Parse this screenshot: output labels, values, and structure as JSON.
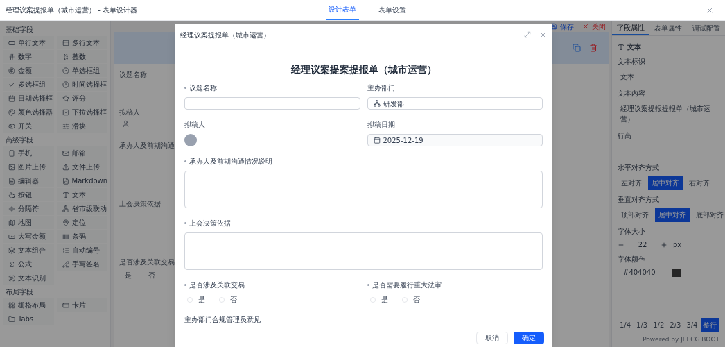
{
  "header": {
    "title": "经理议案提报单（城市运营） - 表单设计器",
    "tabs": [
      {
        "label": "设计表单",
        "selected": true
      },
      {
        "label": "表单设置",
        "selected": false
      }
    ]
  },
  "palette": {
    "sections": [
      {
        "title": "基础字段",
        "items": [
          "单行文本",
          "多行文本",
          "数字",
          "整数",
          "金额",
          "单选框组",
          "多选框组",
          "时间选择框",
          "日期选择框",
          "评分",
          "颜色选择器",
          "下拉选择框",
          "开关",
          "滑块"
        ]
      },
      {
        "title": "高级字段",
        "items": [
          "手机",
          "邮箱",
          "图片上传",
          "文件上传",
          "编辑器",
          "Markdown",
          "按钮",
          "文本",
          "分隔符",
          "省市级联动",
          "地图",
          "定位",
          "大写金额",
          "条码",
          "文本组合",
          "自动编号",
          "公式",
          "手写签名",
          "文本识别"
        ]
      },
      {
        "title": "布局字段",
        "items": [
          "栅格布局",
          "卡片",
          "Tabs"
        ]
      }
    ]
  },
  "canvas": {
    "toolbar": [
      "保存",
      "关闭"
    ],
    "fields": [
      {
        "label": "议题名称",
        "kind": "input"
      },
      {
        "label": "拟稿人",
        "kind": "user"
      },
      {
        "label": "承办人及前期沟通",
        "kind": "textarea"
      },
      {
        "label": "上会决策依据",
        "kind": "textarea"
      },
      {
        "label": "是否涉及关联交易",
        "kind": "radio",
        "options": [
          "是",
          "否"
        ]
      }
    ]
  },
  "properties": {
    "tabs": [
      {
        "label": "字段属性",
        "selected": true
      },
      {
        "label": "表单属性",
        "selected": false
      },
      {
        "label": "调试配置",
        "selected": false
      }
    ],
    "component": "文本",
    "groups": [
      {
        "kind": "text",
        "label": "文本标识",
        "value": "文本"
      },
      {
        "kind": "text",
        "label": "文本内容",
        "value": "经理议案提报提报单（城市运营）"
      },
      {
        "kind": "empty",
        "label": "行高"
      },
      {
        "kind": "segmented",
        "label": "水平对齐方式",
        "options": [
          {
            "label": "左对齐",
            "selected": false
          },
          {
            "label": "居中对齐",
            "selected": true
          },
          {
            "label": "右对齐",
            "selected": false
          }
        ]
      },
      {
        "kind": "segmented",
        "label": "垂直对齐方式",
        "options": [
          {
            "label": "顶部对齐",
            "selected": false
          },
          {
            "label": "居中对齐",
            "selected": true
          },
          {
            "label": "底部对齐",
            "selected": false
          }
        ]
      },
      {
        "kind": "stepper",
        "label": "字体大小",
        "value": "22",
        "unit": "px"
      },
      {
        "kind": "color",
        "label": "字体颜色",
        "value": "#404040"
      },
      {
        "kind": "widths",
        "options": [
          {
            "label": "1/4",
            "selected": false
          },
          {
            "label": "1/3",
            "selected": false
          },
          {
            "label": "1/2",
            "selected": false
          },
          {
            "label": "2/3",
            "selected": false
          },
          {
            "label": "3/4",
            "selected": false
          },
          {
            "label": "整行",
            "selected": true
          }
        ]
      }
    ],
    "footer": "Powered by JEECG BOOT"
  },
  "modal": {
    "title": "经理议案提报单（城市运营）",
    "heading": "经理议案提案提报单（城市运营）",
    "fields": [
      {
        "kind": "input",
        "label": "议题名称",
        "required": true
      },
      {
        "kind": "dept",
        "label": "主办部门",
        "required": false,
        "value": "研发部"
      },
      {
        "kind": "user",
        "label": "拟稿人",
        "required": false
      },
      {
        "kind": "date",
        "label": "拟稿日期",
        "required": false,
        "value": "2025-12-19"
      },
      {
        "kind": "textarea",
        "label": "承办人及前期沟通情况说明",
        "required": true
      },
      {
        "kind": "textarea",
        "label": "上会决策依据",
        "required": true
      },
      {
        "kind": "radio",
        "label": "是否涉及关联交易",
        "required": true,
        "options": [
          {
            "label": "是",
            "selected": false
          },
          {
            "label": "否",
            "selected": false
          }
        ]
      },
      {
        "kind": "radio",
        "label": "是否需要履行重大法审",
        "required": true,
        "options": [
          {
            "label": "是",
            "selected": false
          },
          {
            "label": "否",
            "selected": false
          }
        ]
      },
      {
        "kind": "textarea",
        "label": "主办部门合规管理员意见",
        "required": false
      }
    ],
    "buttons": [
      {
        "label": "取消",
        "primary": false
      },
      {
        "label": "确定",
        "primary": true
      }
    ]
  }
}
